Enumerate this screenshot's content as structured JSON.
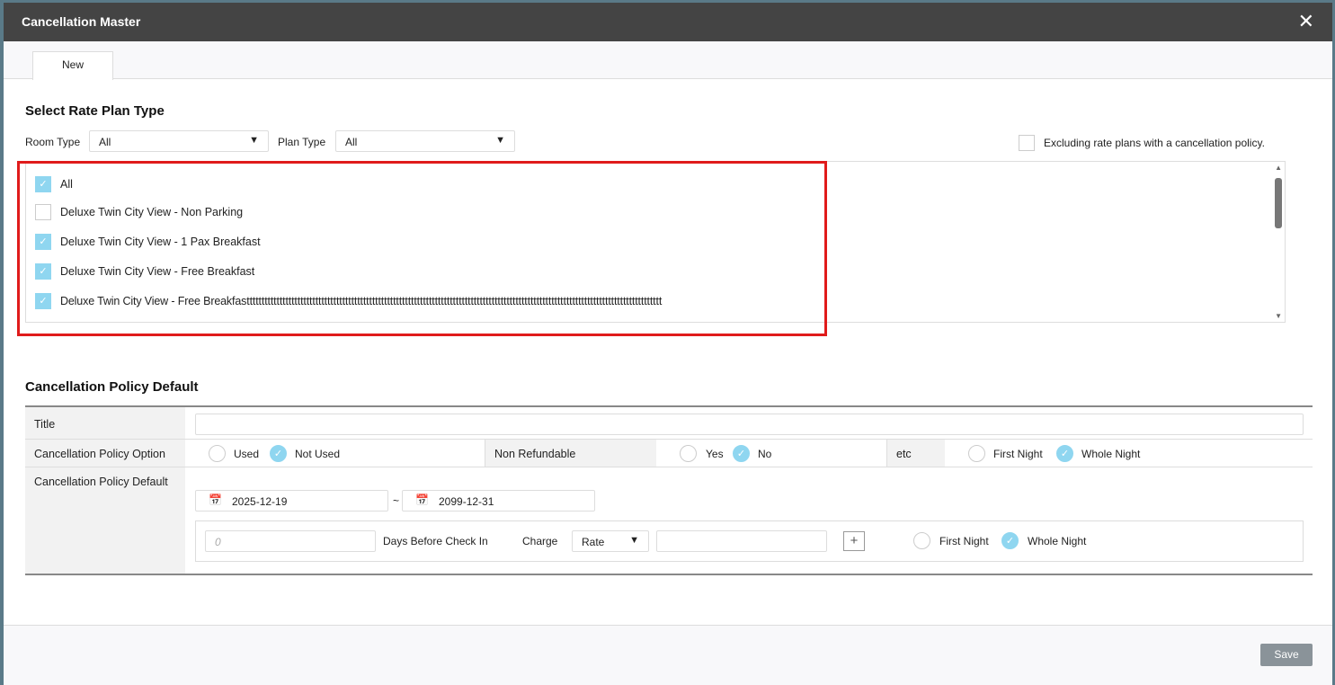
{
  "window": {
    "title": "Cancellation Master",
    "close": "✕"
  },
  "tabs": [
    {
      "label": "New"
    }
  ],
  "rate_plan": {
    "title": "Select Rate Plan Type",
    "room_type_label": "Room Type",
    "room_type_value": "All",
    "plan_type_label": "Plan Type",
    "plan_type_value": "All",
    "exclude_label": "Excluding rate plans with a cancellation policy.",
    "items": [
      {
        "label": "All",
        "checked": true
      },
      {
        "label": "Deluxe Twin City View - Non Parking",
        "checked": false
      },
      {
        "label": "Deluxe Twin City View - 1 Pax Breakfast",
        "checked": true
      },
      {
        "label": "Deluxe Twin City View - Free Breakfast",
        "checked": true
      },
      {
        "label": "Deluxe Twin City View - Free Breakfasttttttttttttttttttttttttttttttttttttttttttttttttttttttttttttttttttttttttttttttttttttttttttttttttttttttttttttttttttttttttttttttttttttttttttt",
        "checked": true
      }
    ]
  },
  "policy": {
    "title": "Cancellation Policy Default",
    "title_label": "Title",
    "title_value": "",
    "option_label": "Cancellation Policy Option",
    "used": "Used",
    "not_used": "Not Used",
    "non_refundable_label": "Non Refundable",
    "yes": "Yes",
    "no": "No",
    "etc_label": "etc",
    "first_night": "First Night",
    "whole_night": "Whole Night",
    "default_label": "Cancellation Policy Default",
    "start_date": "2025-12-19",
    "sep": "~",
    "end_date": "2099-12-31",
    "days_placeholder": "0",
    "days_label": "Days Before Check In",
    "charge_label": "Charge",
    "charge_value": "Rate",
    "charge_amount": "",
    "add": "+",
    "first_night2": "First Night",
    "whole_night2": "Whole Night"
  },
  "footer": {
    "save": "Save"
  }
}
